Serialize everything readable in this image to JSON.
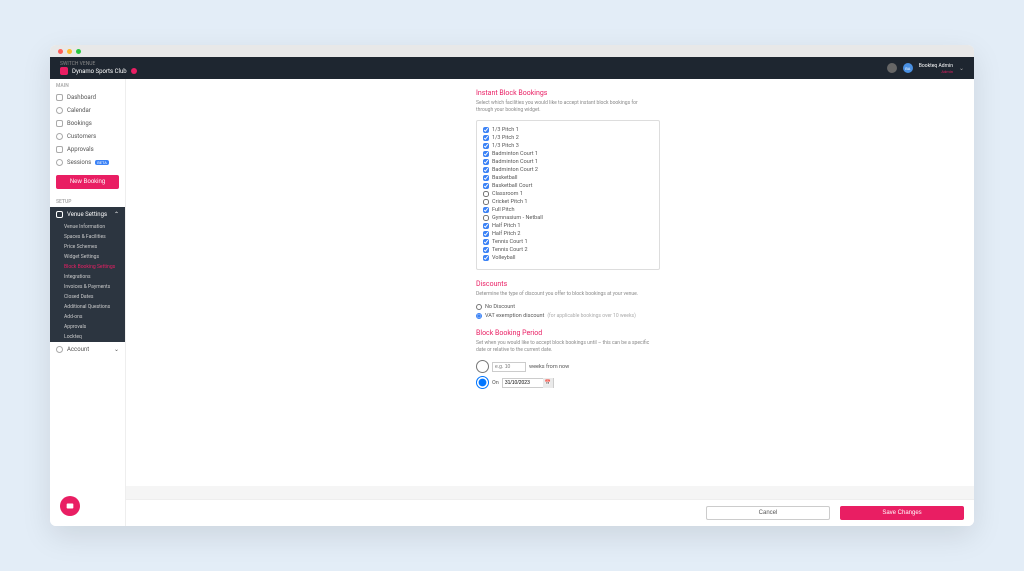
{
  "topbar": {
    "switch_label": "SWITCH VENUE",
    "venue_name": "Dynamo Sports Club",
    "user_name": "Bookteq Admin",
    "user_role": "Admin",
    "avatar_initials": "BA"
  },
  "sidebar": {
    "main_label": "MAIN",
    "items": [
      {
        "label": "Dashboard"
      },
      {
        "label": "Calendar"
      },
      {
        "label": "Bookings"
      },
      {
        "label": "Customers"
      },
      {
        "label": "Approvals"
      },
      {
        "label": "Sessions",
        "badge": "BETA"
      }
    ],
    "new_booking": "New Booking",
    "setup_label": "SETUP",
    "venue_settings": "Venue Settings",
    "sub_items": [
      "Venue Information",
      "Spaces & Facilities",
      "Price Schemes",
      "Widget Settings",
      "Block Booking Settings",
      "Integrations",
      "Invoices & Payments",
      "Closed Dates",
      "Additional Questions",
      "Add-ons",
      "Approvals",
      "Lockteq"
    ],
    "account": "Account"
  },
  "content": {
    "instant": {
      "title": "Instant Block Bookings",
      "desc": "Select which facilities you would like to accept instant block bookings for through your booking widget.",
      "facilities": [
        {
          "label": "1/3 Pitch 1",
          "checked": true
        },
        {
          "label": "1/3 Pitch 2",
          "checked": true
        },
        {
          "label": "1/3 Pitch 3",
          "checked": true
        },
        {
          "label": "Badminton Court 1",
          "checked": true
        },
        {
          "label": "Badminton Court 1",
          "checked": true
        },
        {
          "label": "Badminton Court 2",
          "checked": true
        },
        {
          "label": "Basketball",
          "checked": true
        },
        {
          "label": "Basketball Court",
          "checked": true
        },
        {
          "label": "Classroom 1",
          "checked": false
        },
        {
          "label": "Cricket Pitch 1",
          "checked": false
        },
        {
          "label": "Full Pitch",
          "checked": true
        },
        {
          "label": "Gymnasium - Netball",
          "checked": false
        },
        {
          "label": "Half Pitch 1",
          "checked": true
        },
        {
          "label": "Half Pitch 2",
          "checked": true
        },
        {
          "label": "Tennis Court 1",
          "checked": true
        },
        {
          "label": "Tennis Court 2",
          "checked": true
        },
        {
          "label": "Volleyball",
          "checked": true
        }
      ]
    },
    "discounts": {
      "title": "Discounts",
      "desc": "Determine the type of discount you offer to block bookings at your venue.",
      "options": [
        {
          "label": "No Discount",
          "checked": false
        },
        {
          "label": "VAT exemption discount",
          "checked": true,
          "note": "(for applicable bookings over 10 weeks)"
        }
      ]
    },
    "period": {
      "title": "Block Booking Period",
      "desc": "Set when you would like to accept block bookings until – this can be a specific date or relative to the current date.",
      "weeks_placeholder": "e.g. 10",
      "weeks_suffix": "weeks from now",
      "on_label": "On",
      "date_value": "31/10/2023"
    },
    "footer": {
      "cancel": "Cancel",
      "save": "Save Changes"
    }
  }
}
